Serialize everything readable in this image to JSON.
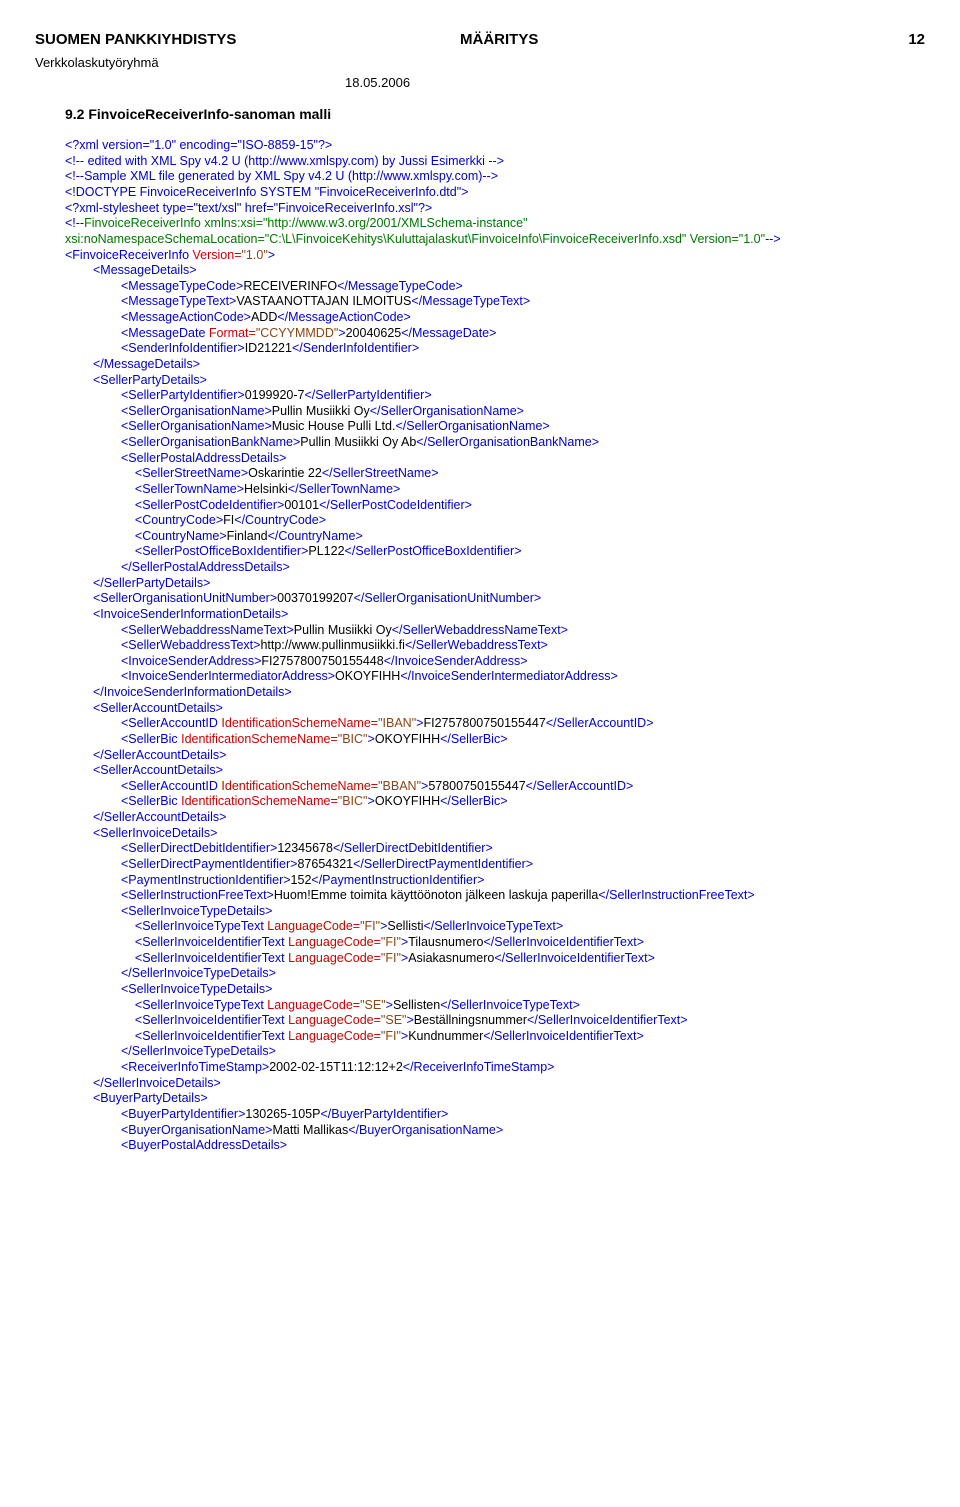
{
  "header": {
    "org": "SUOMEN PANKKIYHDISTYS",
    "doctype": "MÄÄRITYS",
    "page": "12",
    "subgroup": "Verkkolaskutyöryhmä",
    "date": "18.05.2006",
    "section": "9.2  FinvoiceReceiverInfo-sanoman malli"
  },
  "xml": {
    "l1": "<?xml version=\"1.0\" encoding=\"ISO-8859-15\"?>",
    "l2": "<!-- edited with XML Spy v4.2 U (http://www.xmlspy.com) by Jussi Esimerkki -->",
    "l3": "<!--Sample XML file generated by XML Spy v4.2 U (http://www.xmlspy.com)-->",
    "l4": "<!DOCTYPE FinvoiceReceiverInfo SYSTEM \"FinvoiceReceiverInfo.dtd\">",
    "l5": "<?xml-stylesheet type=\"text/xsl\" href=\"FinvoiceReceiverInfo.xsl\"?>",
    "l6a": "<!--",
    "l6b": "FinvoiceReceiverInfo xmlns:xsi=\"http://www.w3.org/2001/XMLSchema-instance\" xsi:noNamespaceSchemaLocation=\"C:\\L\\FinvoiceKehitys\\Kuluttajalaskut\\FinvoiceInfo\\FinvoiceReceiverInfo.xsd\" Version=\"1.0\"",
    "l6c": "-->",
    "root_open": "<FinvoiceReceiverInfo",
    "root_attr": " Version=",
    "root_val": "\"1.0\"",
    "root_close": ">",
    "tags": {
      "MessageDetails_o": "<MessageDetails>",
      "MessageDetails_c": "</MessageDetails>",
      "MessageTypeCode_o": "<MessageTypeCode>",
      "MessageTypeCode_v": "RECEIVERINFO",
      "MessageTypeCode_c": "</MessageTypeCode>",
      "MessageTypeText_o": "<MessageTypeText>",
      "MessageTypeText_v": "VASTAANOTTAJAN ILMOITUS",
      "MessageTypeText_c": "</MessageTypeText>",
      "MessageActionCode_o": "<MessageActionCode>",
      "MessageActionCode_v": "ADD",
      "MessageActionCode_c": "</MessageActionCode>",
      "MessageDate_o": "<MessageDate",
      "MessageDate_a": " Format=",
      "MessageDate_av": "\"CCYYMMDD\"",
      "MessageDate_v": "20040625",
      "MessageDate_c": "</MessageDate>",
      "SenderInfoIdentifier_o": "<SenderInfoIdentifier>",
      "SenderInfoIdentifier_v": "ID21221",
      "SenderInfoIdentifier_c": "</SenderInfoIdentifier>",
      "SellerPartyDetails_o": "<SellerPartyDetails>",
      "SellerPartyDetails_c": "</SellerPartyDetails>",
      "SellerPartyIdentifier_o": "<SellerPartyIdentifier>",
      "SellerPartyIdentifier_v": "0199920-7",
      "SellerPartyIdentifier_c": "</SellerPartyIdentifier>",
      "SellerOrganisationName_o": "<SellerOrganisationName>",
      "SellerOrganisationName_v1": "Pullin Musiikki Oy",
      "SellerOrganisationName_v2": "Music House Pulli Ltd.",
      "SellerOrganisationName_c": "</SellerOrganisationName>",
      "SellerOrganisationBankName_o": "<SellerOrganisationBankName>",
      "SellerOrganisationBankName_v": "Pullin Musiikki Oy Ab",
      "SellerOrganisationBankName_c": "</SellerOrganisationBankName>",
      "SellerPostalAddressDetails_o": "<SellerPostalAddressDetails>",
      "SellerPostalAddressDetails_c": "</SellerPostalAddressDetails>",
      "SellerStreetName_o": "<SellerStreetName>",
      "SellerStreetName_v": "Oskarintie 22",
      "SellerStreetName_c": "</SellerStreetName>",
      "SellerTownName_o": "<SellerTownName>",
      "SellerTownName_v": "Helsinki",
      "SellerTownName_c": "</SellerTownName>",
      "SellerPostCodeIdentifier_o": "<SellerPostCodeIdentifier>",
      "SellerPostCodeIdentifier_v": "00101",
      "SellerPostCodeIdentifier_c": "</SellerPostCodeIdentifier>",
      "CountryCode_o": "<CountryCode>",
      "CountryCode_v": "FI",
      "CountryCode_c": "</CountryCode>",
      "CountryName_o": "<CountryName>",
      "CountryName_v": "Finland",
      "CountryName_c": "</CountryName>",
      "SellerPostOfficeBoxIdentifier_o": "<SellerPostOfficeBoxIdentifier>",
      "SellerPostOfficeBoxIdentifier_v": "PL122",
      "SellerPostOfficeBoxIdentifier_c": "</SellerPostOfficeBoxIdentifier>",
      "SellerOrganisationUnitNumber_o": "<SellerOrganisationUnitNumber>",
      "SellerOrganisationUnitNumber_v": "00370199207",
      "SellerOrganisationUnitNumber_c": "</SellerOrganisationUnitNumber>",
      "InvoiceSenderInformationDetails_o": "<InvoiceSenderInformationDetails>",
      "InvoiceSenderInformationDetails_c": "</InvoiceSenderInformationDetails>",
      "SellerWebaddressNameText_o": "<SellerWebaddressNameText>",
      "SellerWebaddressNameText_v": "Pullin Musiikki Oy",
      "SellerWebaddressNameText_c": "</SellerWebaddressNameText>",
      "SellerWebaddressText_o": "<SellerWebaddressText>",
      "SellerWebaddressText_v": "http://www.pullinmusiikki.fi",
      "SellerWebaddressText_c": "</SellerWebaddressText>",
      "InvoiceSenderAddress_o": "<InvoiceSenderAddress>",
      "InvoiceSenderAddress_v": "FI2757800750155448",
      "InvoiceSenderAddress_c": "</InvoiceSenderAddress>",
      "InvoiceSenderIntermediatorAddress_o": "<InvoiceSenderIntermediatorAddress>",
      "InvoiceSenderIntermediatorAddress_v": "OKOYFIHH",
      "InvoiceSenderIntermediatorAddress_c": "</InvoiceSenderIntermediatorAddress>",
      "SellerAccountDetails_o": "<SellerAccountDetails>",
      "SellerAccountDetails_c": "</SellerAccountDetails>",
      "SellerAccountID_o": "<SellerAccountID",
      "SellerAccountID_a": " IdentificationSchemeName=",
      "SellerAccountID_av1": "\"IBAN\"",
      "SellerAccountID_v1": "FI2757800750155447",
      "SellerAccountID_av2": "\"BBAN\"",
      "SellerAccountID_v2": "57800750155447",
      "SellerAccountID_c": "</SellerAccountID>",
      "SellerBic_o": "<SellerBic",
      "SellerBic_a": " IdentificationSchemeName=",
      "SellerBic_av": "\"BIC\"",
      "SellerBic_v": "OKOYFIHH",
      "SellerBic_c": "</SellerBic>",
      "SellerInvoiceDetails_o": "<SellerInvoiceDetails>",
      "SellerInvoiceDetails_c": "</SellerInvoiceDetails>",
      "SellerDirectDebitIdentifier_o": "<SellerDirectDebitIdentifier>",
      "SellerDirectDebitIdentifier_v": "12345678",
      "SellerDirectDebitIdentifier_c": "</SellerDirectDebitIdentifier>",
      "SellerDirectPaymentIdentifier_o": "<SellerDirectPaymentIdentifier>",
      "SellerDirectPaymentIdentifier_v": "87654321",
      "SellerDirectPaymentIdentifier_c": "</SellerDirectPaymentIdentifier>",
      "PaymentInstructionIdentifier_o": "<PaymentInstructionIdentifier>",
      "PaymentInstructionIdentifier_v": "152",
      "PaymentInstructionIdentifier_c": "</PaymentInstructionIdentifier>",
      "SellerInstructionFreeText_o": "<SellerInstructionFreeText>",
      "SellerInstructionFreeText_v": "Huom!Emme toimita käyttöönoton jälkeen laskuja paperilla",
      "SellerInstructionFreeText_c": "</SellerInstructionFreeText>",
      "SellerInvoiceTypeDetails_o": "<SellerInvoiceTypeDetails>",
      "SellerInvoiceTypeDetails_c": "</SellerInvoiceTypeDetails>",
      "SellerInvoiceTypeText_o": "<SellerInvoiceTypeText",
      "SellerInvoiceTypeText_c": "</SellerInvoiceTypeText>",
      "SellerInvoiceIdentifierText_o": "<SellerInvoiceIdentifierText",
      "SellerInvoiceIdentifierText_c": "</SellerInvoiceIdentifierText>",
      "lang_a": " LanguageCode=",
      "lang_fi": "\"FI\"",
      "lang_se": "\"SE\"",
      "type_fi": "Sellisti",
      "ident_fi1": "Tilausnumero",
      "ident_fi2": "Asiakasnumero",
      "type_se": "Sellisten",
      "ident_se": "Beställningsnummer",
      "ident_fi3": "Kundnummer",
      "ReceiverInfoTimeStamp_o": "<ReceiverInfoTimeStamp>",
      "ReceiverInfoTimeStamp_v": "2002-02-15T11:12:12+2",
      "ReceiverInfoTimeStamp_c": "</ReceiverInfoTimeStamp>",
      "BuyerPartyDetails_o": "<BuyerPartyDetails>",
      "BuyerPartyIdentifier_o": "<BuyerPartyIdentifier>",
      "BuyerPartyIdentifier_v": "130265-105P",
      "BuyerPartyIdentifier_c": "</BuyerPartyIdentifier>",
      "BuyerOrganisationName_o": "<BuyerOrganisationName>",
      "BuyerOrganisationName_v": "Matti Mallikas",
      "BuyerOrganisationName_c": "</BuyerOrganisationName>",
      "BuyerPostalAddressDetails_o": "<BuyerPostalAddressDetails>",
      "gt": ">"
    }
  }
}
